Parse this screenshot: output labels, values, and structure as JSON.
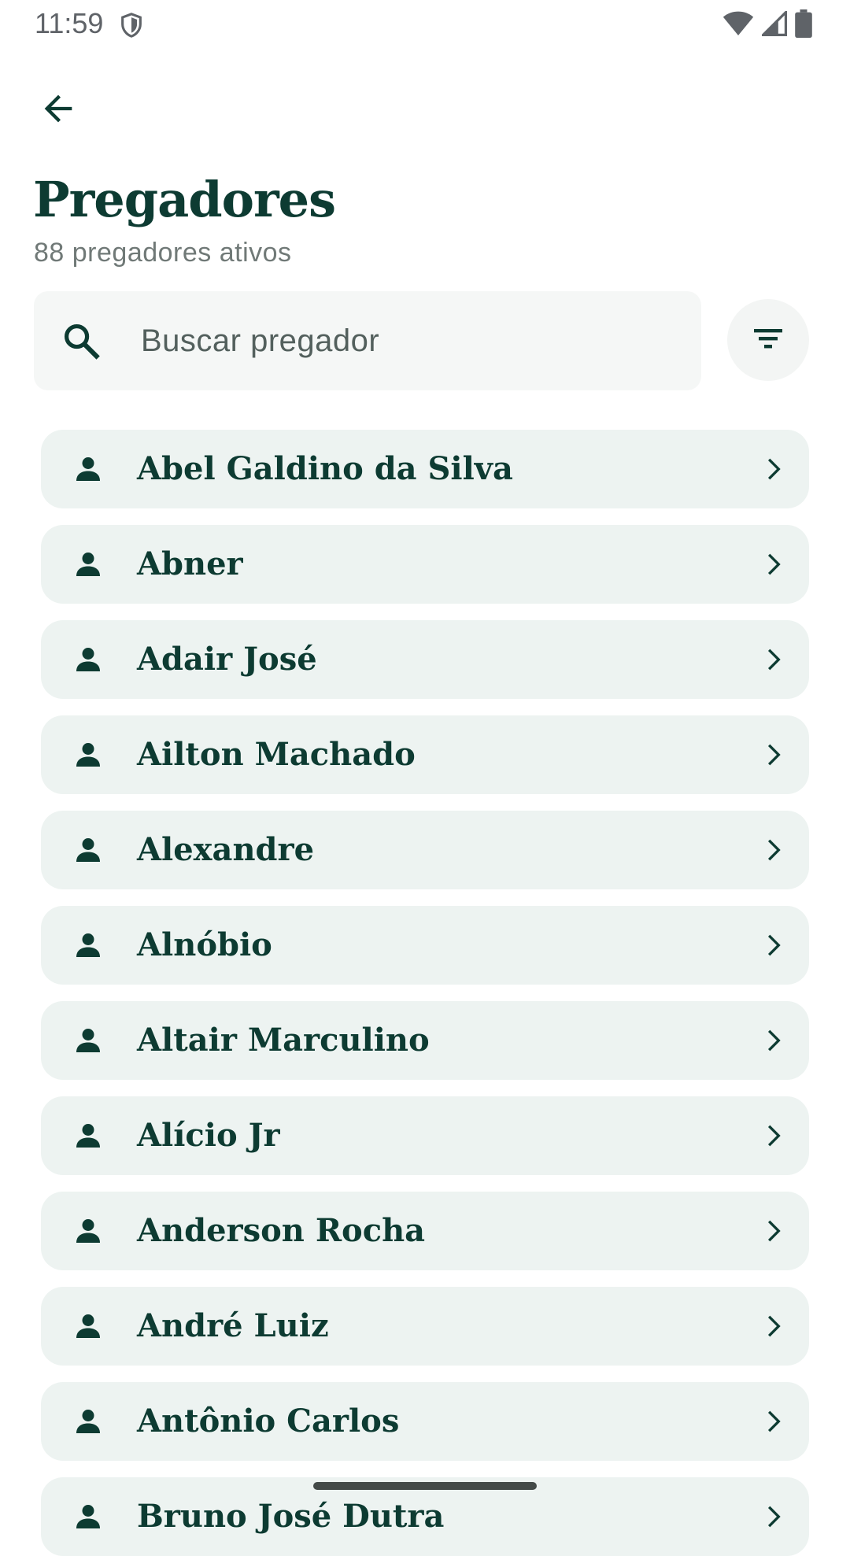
{
  "status_bar": {
    "time": "11:59",
    "icons": [
      "shield-icon",
      "wifi-icon",
      "signal-icon",
      "battery-icon"
    ]
  },
  "header": {
    "back_icon": "arrow-back-icon",
    "title": "Pregadores",
    "subtitle": "88 pregadores ativos"
  },
  "search": {
    "placeholder": "Buscar pregador",
    "value": "",
    "icon": "search-icon"
  },
  "filter": {
    "icon": "filter-icon"
  },
  "preachers": [
    {
      "name": "Abel Galdino da Silva"
    },
    {
      "name": "Abner"
    },
    {
      "name": "Adair José"
    },
    {
      "name": "Ailton Machado"
    },
    {
      "name": "Alexandre"
    },
    {
      "name": "Alnóbio"
    },
    {
      "name": "Altair Marculino"
    },
    {
      "name": "Alício Jr"
    },
    {
      "name": "Anderson Rocha"
    },
    {
      "name": "André Luiz"
    },
    {
      "name": "Antônio Carlos"
    },
    {
      "name": "Bruno José Dutra"
    }
  ],
  "colors": {
    "primary": "#0d3b32",
    "item_background": "#edf3f1",
    "search_background": "#f5f7f6",
    "subtitle": "#707977"
  }
}
